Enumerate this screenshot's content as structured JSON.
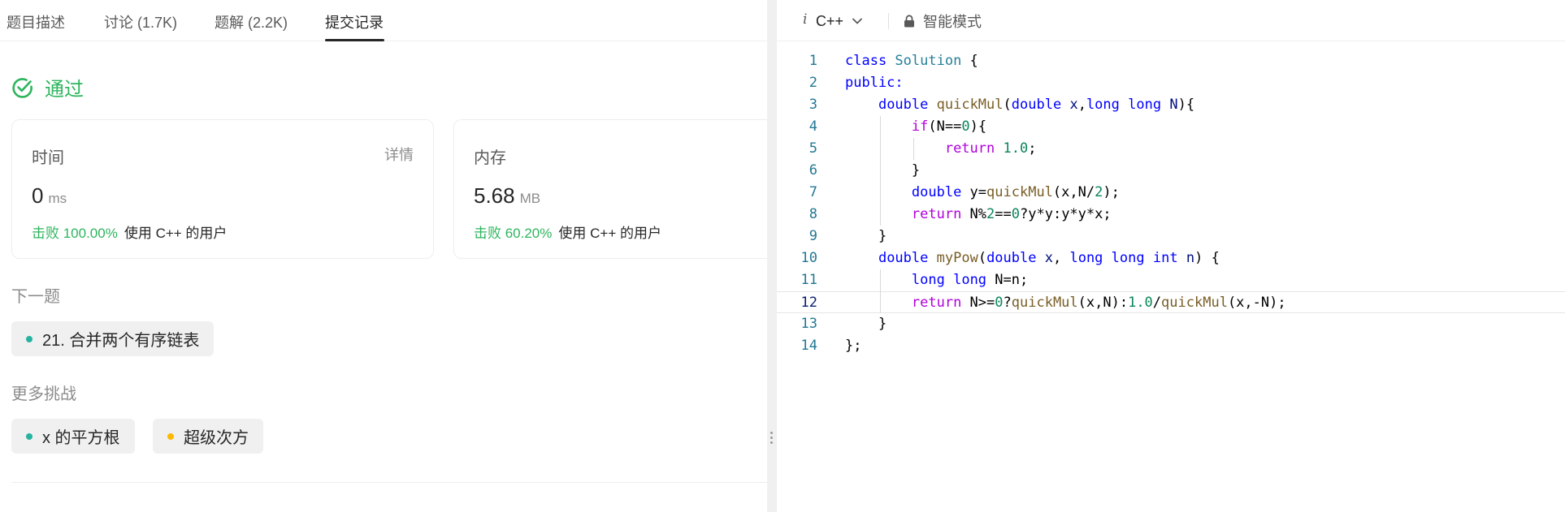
{
  "tabs": [
    {
      "label": "题目描述"
    },
    {
      "label": "讨论 (1.7K)"
    },
    {
      "label": "题解 (2.2K)"
    },
    {
      "label": "提交记录",
      "active": true
    }
  ],
  "result": {
    "status": "通过",
    "color": "#2db55d"
  },
  "time_card": {
    "title": "时间",
    "detail_link": "详情",
    "value": "0",
    "unit": "ms",
    "beat": "击败 100.00%",
    "users": "使用 C++ 的用户"
  },
  "memory_card": {
    "title": "内存",
    "value": "5.68",
    "unit": "MB",
    "beat": "击败 60.20%",
    "users": "使用 C++ 的用户"
  },
  "next": {
    "label": "下一题",
    "item": {
      "title": "21. 合并两个有序链表",
      "dot_color": "#26b3a0"
    }
  },
  "more": {
    "label": "更多挑战",
    "items": [
      {
        "title": "x 的平方根",
        "dot_color": "#26b3a0"
      },
      {
        "title": "超级次方",
        "dot_color": "#ffb800"
      }
    ]
  },
  "editor": {
    "lang_icon": "i",
    "language": "C++",
    "mode": "智能模式",
    "current_line": 12,
    "lines": [
      [
        [
          "class ",
          "kw"
        ],
        [
          "Solution",
          "ty"
        ],
        [
          " {",
          ""
        ]
      ],
      [
        [
          "public:",
          "kw"
        ]
      ],
      [
        [
          "    ",
          ""
        ],
        [
          "double",
          "kw"
        ],
        [
          " ",
          ""
        ],
        [
          "quickMul",
          "fn"
        ],
        [
          "(",
          ""
        ],
        [
          "double",
          "kw"
        ],
        [
          " ",
          ""
        ],
        [
          "x",
          "var"
        ],
        [
          ",",
          ""
        ],
        [
          "long",
          "kw"
        ],
        [
          " ",
          ""
        ],
        [
          "long",
          "kw"
        ],
        [
          " ",
          ""
        ],
        [
          "N",
          "var"
        ],
        [
          "){",
          ""
        ]
      ],
      [
        [
          "        ",
          ""
        ],
        [
          "if",
          "ctl"
        ],
        [
          "(N==",
          ""
        ],
        [
          "0",
          "num"
        ],
        [
          "){",
          ""
        ]
      ],
      [
        [
          "            ",
          ""
        ],
        [
          "return",
          "ctl"
        ],
        [
          " ",
          ""
        ],
        [
          "1.0",
          "num"
        ],
        [
          ";",
          ""
        ]
      ],
      [
        [
          "        }",
          ""
        ]
      ],
      [
        [
          "        ",
          ""
        ],
        [
          "double",
          "kw"
        ],
        [
          " y=",
          ""
        ],
        [
          "quickMul",
          "fn"
        ],
        [
          "(x,N/",
          ""
        ],
        [
          "2",
          "num"
        ],
        [
          ");",
          ""
        ]
      ],
      [
        [
          "        ",
          ""
        ],
        [
          "return",
          "ctl"
        ],
        [
          " N%",
          ""
        ],
        [
          "2",
          "num"
        ],
        [
          "==",
          ""
        ],
        [
          "0",
          "num"
        ],
        [
          "?y*y:y*y*x;",
          ""
        ]
      ],
      [
        [
          "    }",
          ""
        ]
      ],
      [
        [
          "    ",
          ""
        ],
        [
          "double",
          "kw"
        ],
        [
          " ",
          ""
        ],
        [
          "myPow",
          "fn"
        ],
        [
          "(",
          ""
        ],
        [
          "double",
          "kw"
        ],
        [
          " ",
          ""
        ],
        [
          "x",
          "var"
        ],
        [
          ", ",
          ""
        ],
        [
          "long",
          "kw"
        ],
        [
          " ",
          ""
        ],
        [
          "long",
          "kw"
        ],
        [
          " ",
          ""
        ],
        [
          "int",
          "kw"
        ],
        [
          " ",
          ""
        ],
        [
          "n",
          "var"
        ],
        [
          ") {",
          ""
        ]
      ],
      [
        [
          "        ",
          ""
        ],
        [
          "long",
          "kw"
        ],
        [
          " ",
          ""
        ],
        [
          "long",
          "kw"
        ],
        [
          " N=n;",
          ""
        ]
      ],
      [
        [
          "        ",
          ""
        ],
        [
          "return",
          "ctl"
        ],
        [
          " N>=",
          ""
        ],
        [
          "0",
          "num"
        ],
        [
          "?",
          ""
        ],
        [
          "quickMul",
          "fn"
        ],
        [
          "(x,N):",
          ""
        ],
        [
          "1.0",
          "num"
        ],
        [
          "/",
          ""
        ],
        [
          "quickMul",
          "fn"
        ],
        [
          "(x,-N);",
          ""
        ]
      ],
      [
        [
          "    }",
          ""
        ]
      ],
      [
        [
          "};",
          ""
        ]
      ]
    ]
  }
}
